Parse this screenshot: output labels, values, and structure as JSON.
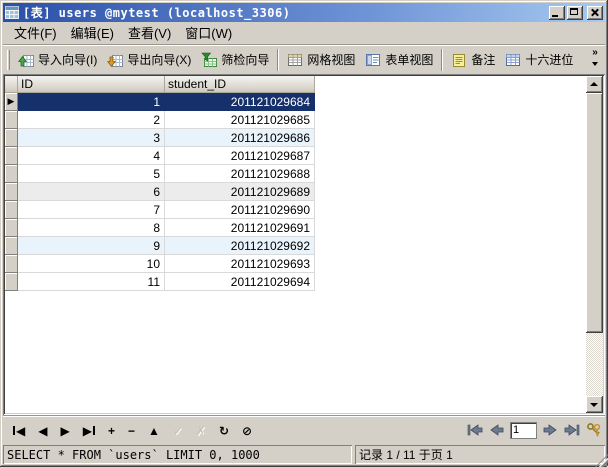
{
  "window": {
    "title": "[表] users @mytest (localhost_3306)"
  },
  "menu_bar": {
    "items": [
      {
        "label": "文件(F)"
      },
      {
        "label": "编辑(E)"
      },
      {
        "label": "查看(V)"
      },
      {
        "label": "窗口(W)"
      }
    ]
  },
  "toolbar": {
    "buttons": [
      {
        "label": "导入向导(I)",
        "icon": "import-wizard-icon"
      },
      {
        "label": "导出向导(X)",
        "icon": "export-wizard-icon"
      },
      {
        "label": "筛检向导",
        "icon": "filter-wizard-icon"
      },
      {
        "label": "网格视图",
        "icon": "grid-view-icon"
      },
      {
        "label": "表单视图",
        "icon": "form-view-icon"
      },
      {
        "label": "备注",
        "icon": "memo-icon"
      },
      {
        "label": "十六进位",
        "icon": "hex-icon"
      }
    ],
    "overflow": "»"
  },
  "table": {
    "columns": [
      "ID",
      "student_ID"
    ],
    "selected_marker": "▶",
    "rows": [
      {
        "ID": "1",
        "student_ID": "201121029684",
        "selected": true,
        "stripe": null
      },
      {
        "ID": "2",
        "student_ID": "201121029685",
        "selected": false,
        "stripe": null
      },
      {
        "ID": "3",
        "student_ID": "201121029686",
        "selected": false,
        "stripe": "blue"
      },
      {
        "ID": "4",
        "student_ID": "201121029687",
        "selected": false,
        "stripe": null
      },
      {
        "ID": "5",
        "student_ID": "201121029688",
        "selected": false,
        "stripe": null
      },
      {
        "ID": "6",
        "student_ID": "201121029689",
        "selected": false,
        "stripe": "gray"
      },
      {
        "ID": "7",
        "student_ID": "201121029690",
        "selected": false,
        "stripe": null
      },
      {
        "ID": "8",
        "student_ID": "201121029691",
        "selected": false,
        "stripe": null
      },
      {
        "ID": "9",
        "student_ID": "201121029692",
        "selected": false,
        "stripe": "blue"
      },
      {
        "ID": "10",
        "student_ID": "201121029693",
        "selected": false,
        "stripe": null
      },
      {
        "ID": "11",
        "student_ID": "201121029694",
        "selected": false,
        "stripe": null
      }
    ]
  },
  "record_nav": {
    "buttons": [
      {
        "name": "first-record",
        "glyph": "◀",
        "bar": "left",
        "disabled": false
      },
      {
        "name": "prev-record",
        "glyph": "◀",
        "bar": null,
        "disabled": false
      },
      {
        "name": "next-record",
        "glyph": "▶",
        "bar": null,
        "disabled": false
      },
      {
        "name": "last-record",
        "glyph": "▶",
        "bar": "right",
        "disabled": false
      },
      {
        "name": "add-record",
        "glyph": "+",
        "bar": null,
        "disabled": false
      },
      {
        "name": "delete-record",
        "glyph": "−",
        "bar": null,
        "disabled": false
      },
      {
        "name": "edit-record",
        "glyph": "▲",
        "bar": null,
        "disabled": false
      },
      {
        "name": "post-edit",
        "glyph": "✓",
        "bar": null,
        "disabled": true
      },
      {
        "name": "cancel-edit",
        "glyph": "✗",
        "bar": null,
        "disabled": true
      },
      {
        "name": "refresh",
        "glyph": "↻",
        "bar": null,
        "disabled": false
      },
      {
        "name": "stop",
        "glyph": "⊘",
        "bar": null,
        "disabled": false
      }
    ]
  },
  "pagination": {
    "page_input_value": "1"
  },
  "status_bar": {
    "sql_text": "SELECT * FROM `users` LIMIT 0, 1000",
    "record_info": "记录 1 / 11 于页 1"
  },
  "colors": {
    "titlebar_left": "#2a50a8",
    "titlebar_right": "#a6caf0",
    "chrome": "#d4d0c8",
    "selected_row": "#15306b",
    "stripe_blue": "#e9f3fc",
    "stripe_gray": "#ececec"
  }
}
